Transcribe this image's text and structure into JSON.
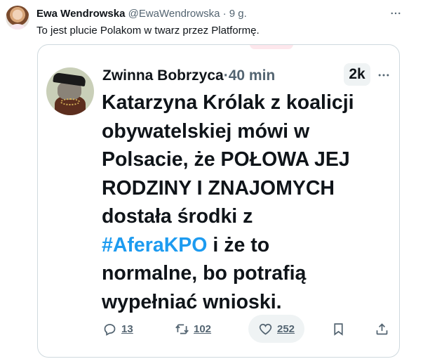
{
  "tweet": {
    "author_name": "Ewa Wendrowska",
    "handle": "@EwaWendrowska",
    "separator": "·",
    "time": "9 g.",
    "text": "To jest plucie Polakom w twarz przez Platformę."
  },
  "embedded": {
    "author_name": "Zwinna Bobrzyca",
    "separator": "·",
    "time": "40 min",
    "badge": "2k",
    "lines": [
      "Katarzyna Królak z koalicji",
      "obywatelskiej mówi w",
      "Polsacie, że POŁOWA JEJ",
      "RODZINY I ZNAJOMYCH",
      "dostała środki z"
    ],
    "hashtag": "#AferaKPO",
    "after_hashtag": " i że to",
    "lines_end": [
      "normalne, bo potrafią",
      "wypełniać wnioski."
    ],
    "actions": {
      "replies": "13",
      "retweets": "102",
      "likes": "252"
    },
    "colors": {
      "hashtag": "#1d9bf0",
      "muted": "#536471"
    }
  },
  "icons": [
    "more-icon",
    "reply-icon",
    "retweet-icon",
    "like-icon",
    "bookmark-icon",
    "share-icon"
  ]
}
